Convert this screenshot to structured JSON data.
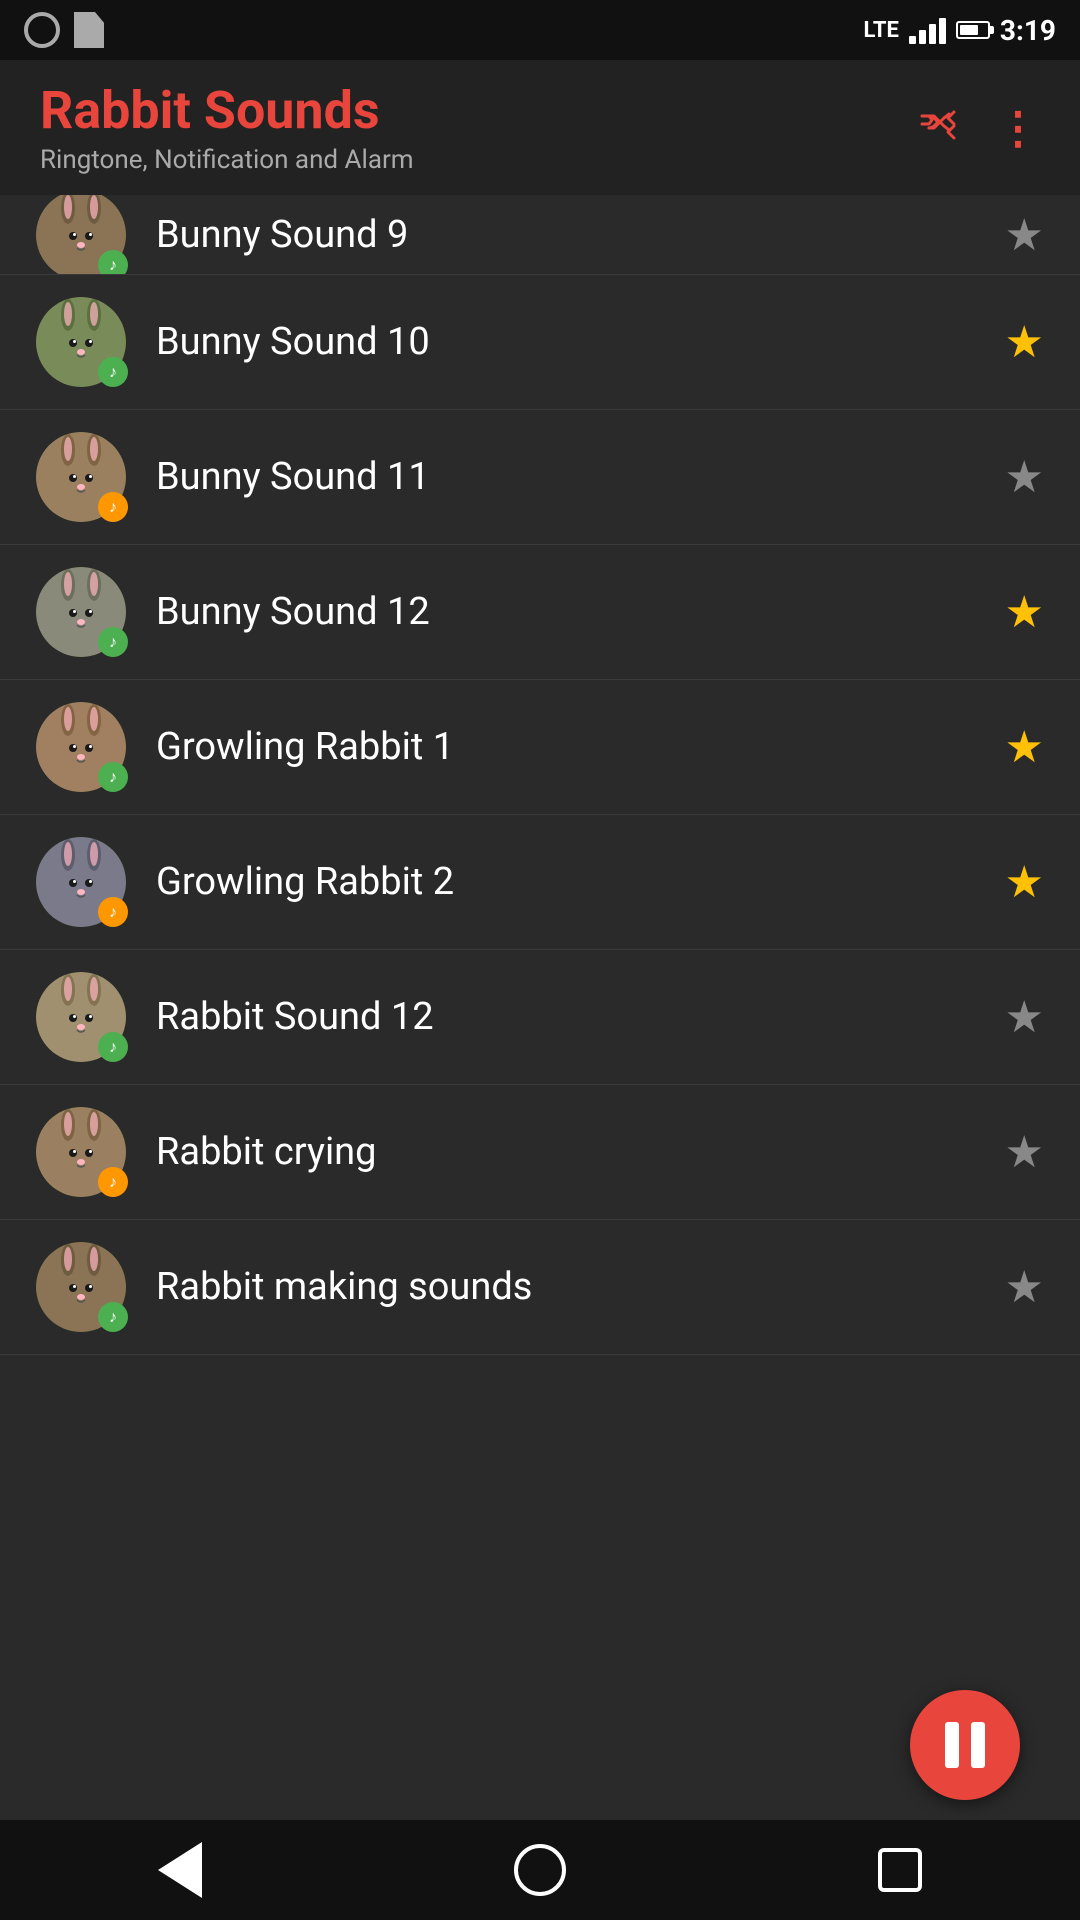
{
  "statusBar": {
    "time": "3:19",
    "lte": "LTE"
  },
  "header": {
    "title": "Rabbit Sounds",
    "subtitle": "Ringtone, Notification and Alarm"
  },
  "sounds": [
    {
      "id": 1,
      "name": "Bunny Sound 9",
      "favorited": false,
      "badgeColor": "green",
      "partial": true,
      "rabbitClass": "rabbit-1"
    },
    {
      "id": 2,
      "name": "Bunny Sound 10",
      "favorited": true,
      "badgeColor": "green",
      "partial": false,
      "rabbitClass": "rabbit-2"
    },
    {
      "id": 3,
      "name": "Bunny Sound 11",
      "favorited": false,
      "badgeColor": "orange",
      "partial": false,
      "rabbitClass": "rabbit-3"
    },
    {
      "id": 4,
      "name": "Bunny Sound 12",
      "favorited": true,
      "badgeColor": "green",
      "partial": false,
      "rabbitClass": "rabbit-4"
    },
    {
      "id": 5,
      "name": "Growling Rabbit 1",
      "favorited": true,
      "badgeColor": "green",
      "partial": false,
      "rabbitClass": "rabbit-5"
    },
    {
      "id": 6,
      "name": "Growling Rabbit 2",
      "favorited": true,
      "badgeColor": "orange",
      "partial": false,
      "rabbitClass": "rabbit-6"
    },
    {
      "id": 7,
      "name": "Rabbit Sound 12",
      "favorited": false,
      "badgeColor": "green",
      "partial": false,
      "rabbitClass": "rabbit-7"
    },
    {
      "id": 8,
      "name": "Rabbit crying",
      "favorited": false,
      "badgeColor": "orange",
      "partial": false,
      "rabbitClass": "rabbit-8"
    },
    {
      "id": 9,
      "name": "Rabbit making sounds",
      "favorited": false,
      "badgeColor": "green",
      "partial": false,
      "rabbitClass": "rabbit-1"
    }
  ],
  "fab": {
    "label": "Pause"
  },
  "nav": {
    "back": "Back",
    "home": "Home",
    "recents": "Recents"
  }
}
